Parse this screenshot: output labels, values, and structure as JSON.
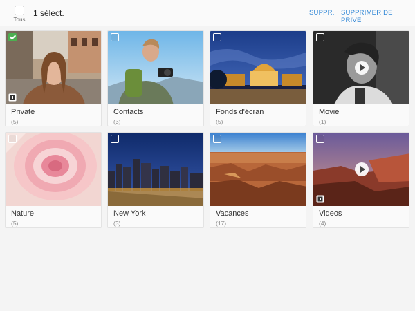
{
  "header": {
    "select_all_label": "Tous",
    "selection_count": "1 sélect.",
    "delete_label": "SUPPR.",
    "remove_private_label": "SUPPRIMER DE PRIVÉ",
    "accent_color": "#2f86d6"
  },
  "albums": [
    {
      "name": "Private",
      "count": "(5)",
      "checked": true,
      "type": "photo",
      "private_badge": true
    },
    {
      "name": "Contacts",
      "count": "(3)",
      "checked": false,
      "type": "photo",
      "private_badge": false
    },
    {
      "name": "Fonds d'écran",
      "count": "(5)",
      "checked": false,
      "type": "photo",
      "private_badge": false
    },
    {
      "name": "Movie",
      "count": "(1)",
      "checked": false,
      "type": "video",
      "private_badge": false
    },
    {
      "name": "Nature",
      "count": "(5)",
      "checked": false,
      "type": "photo",
      "private_badge": false
    },
    {
      "name": "New York",
      "count": "(3)",
      "checked": false,
      "type": "photo",
      "private_badge": false
    },
    {
      "name": "Vacances",
      "count": "(17)",
      "checked": false,
      "type": "photo",
      "private_badge": false
    },
    {
      "name": "Videos",
      "count": "(4)",
      "checked": false,
      "type": "video",
      "private_badge": true
    }
  ]
}
